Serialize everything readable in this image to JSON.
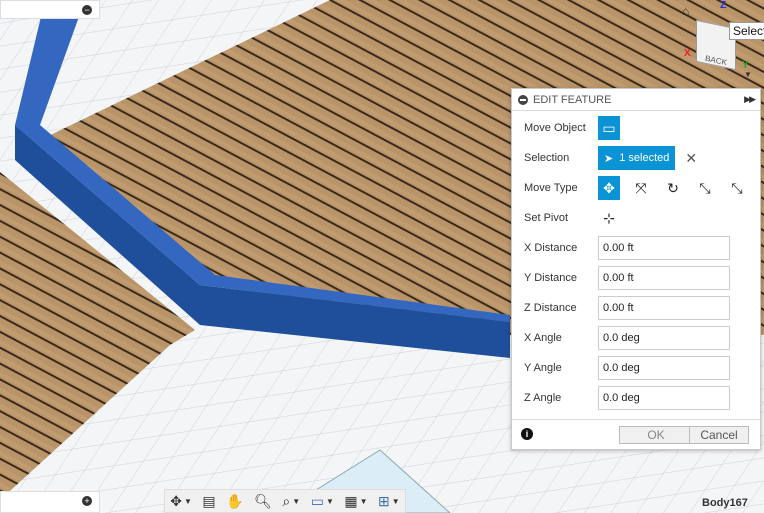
{
  "edit_feature": {
    "title": "EDIT FEATURE",
    "move_object_label": "Move Object",
    "selection_label": "Selection",
    "selection_value": "1 selected",
    "move_type_label": "Move Type",
    "set_pivot_label": "Set Pivot",
    "fields": [
      {
        "label": "X Distance",
        "value": "0.00 ft"
      },
      {
        "label": "Y Distance",
        "value": "0.00 ft"
      },
      {
        "label": "Z Distance",
        "value": "0.00 ft"
      },
      {
        "label": "X Angle",
        "value": "0.0 deg"
      },
      {
        "label": "Y Angle",
        "value": "0.0 deg"
      },
      {
        "label": "Z Angle",
        "value": "0.0 deg"
      }
    ],
    "ok_label": "OK",
    "cancel_label": "Cancel"
  },
  "viewcube": {
    "face_label": "BACK",
    "tooltip": "Select",
    "axes": [
      "X",
      "Y",
      "Z"
    ]
  },
  "status": {
    "body_label": "Body167"
  },
  "colors": {
    "accent": "#0a94d6",
    "beam": "#2e62b4",
    "wood": "#b08a5c"
  }
}
